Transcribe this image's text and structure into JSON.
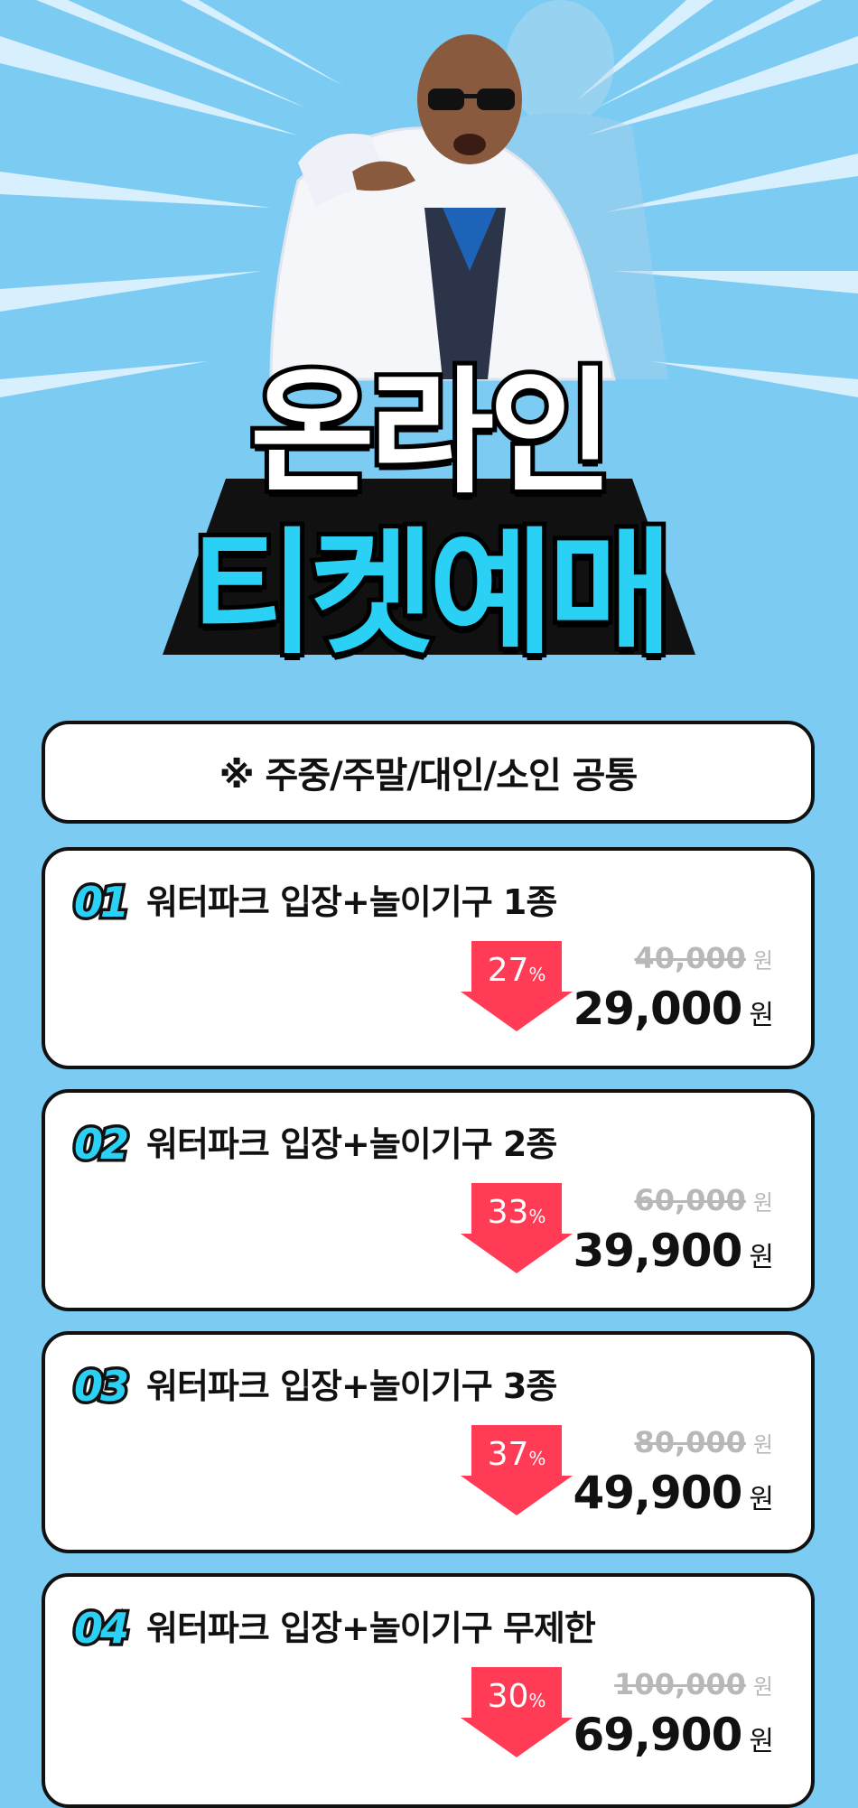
{
  "title": {
    "line1": "온라인",
    "line2": "티켓예매"
  },
  "notice": "※ 주중/주말/대인/소인 공통",
  "colors": {
    "background": "#7ccbf3",
    "accent": "#2ad1f4",
    "discount": "#ff3b55"
  },
  "tickets": [
    {
      "num": "01",
      "name": "워터파크 입장+놀이기구 1종",
      "discount": "27",
      "discount_unit": "%",
      "original": "40,000",
      "price": "29,000",
      "unit": "원"
    },
    {
      "num": "02",
      "name": "워터파크 입장+놀이기구 2종",
      "discount": "33",
      "discount_unit": "%",
      "original": "60,000",
      "price": "39,900",
      "unit": "원"
    },
    {
      "num": "03",
      "name": "워터파크 입장+놀이기구 3종",
      "discount": "37",
      "discount_unit": "%",
      "original": "80,000",
      "price": "49,900",
      "unit": "원"
    },
    {
      "num": "04",
      "name": "워터파크 입장+놀이기구 무제한",
      "discount": "30",
      "discount_unit": "%",
      "original": "100,000",
      "price": "69,900",
      "unit": "원"
    }
  ]
}
